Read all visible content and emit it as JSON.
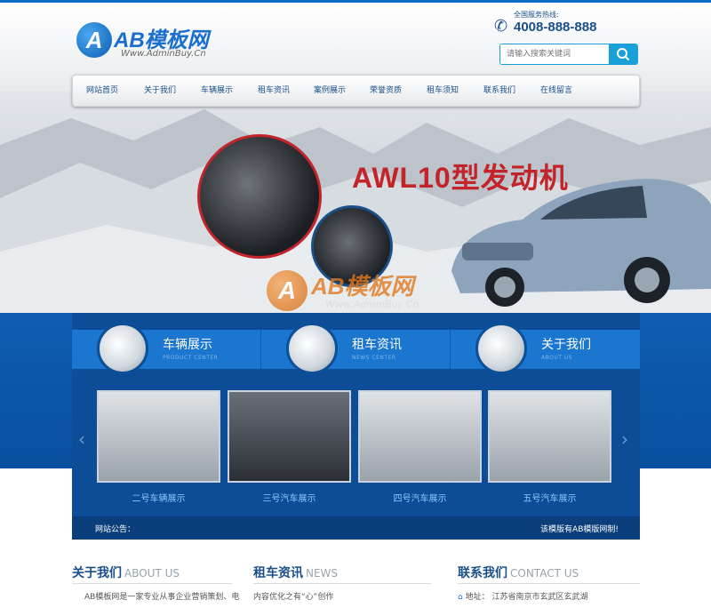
{
  "header": {
    "logo_mark": "A",
    "logo_name": "AB模板网",
    "logo_url": "Www.AdminBuy.Cn",
    "hotline_label": "全国服务热线:",
    "hotline_number": "4008-888-888",
    "search_placeholder": "请输入搜索关键词"
  },
  "nav": {
    "items": [
      {
        "label": "网站首页"
      },
      {
        "label": "关于我们"
      },
      {
        "label": "车辆展示"
      },
      {
        "label": "租车资讯"
      },
      {
        "label": "案例展示"
      },
      {
        "label": "荣誉资质"
      },
      {
        "label": "租车须知"
      },
      {
        "label": "联系我们"
      },
      {
        "label": "在线留言"
      }
    ]
  },
  "banner": {
    "headline": "AWL10型发动机",
    "watermark_mark": "A",
    "watermark_name": "AB模板网",
    "watermark_url": "Www.AdminBuy.Cn"
  },
  "categories": [
    {
      "title": "车辆展示",
      "subtitle": "PRODUCT CENTER",
      "icon": "wheel-icon"
    },
    {
      "title": "租车资讯",
      "subtitle": "NEWS CENTER",
      "icon": "car-icon"
    },
    {
      "title": "关于我们",
      "subtitle": "ABOUT US",
      "icon": "brake-disc-icon"
    }
  ],
  "products": [
    {
      "label": "二号车辆展示"
    },
    {
      "label": "三号汽车展示"
    },
    {
      "label": "四号汽车展示"
    },
    {
      "label": "五号汽车展示"
    }
  ],
  "notice": {
    "label": "网站公告：",
    "text": "该模版有AB模版网制!"
  },
  "sections": {
    "about": {
      "title": "关于我们",
      "title_en": "ABOUT US",
      "text": "AB模板网是一家专业从事企业营销策划、电"
    },
    "news": {
      "title": "租车资讯",
      "title_en": "NEWS",
      "text": "内容优化之有“心”创作"
    },
    "contact": {
      "title": "联系我们",
      "title_en": "CONTACT US",
      "text": "地址：  江苏省南京市玄武区玄武湖"
    }
  },
  "colors": {
    "brand": "#1a6fce",
    "nav_text": "#1a4f8a",
    "panel": "#0d4d97",
    "accent_red": "#c2242a"
  }
}
